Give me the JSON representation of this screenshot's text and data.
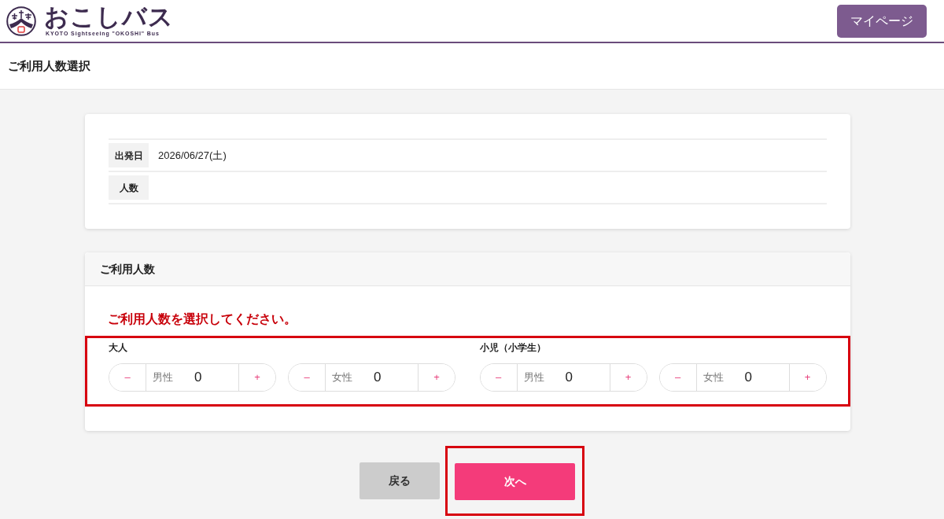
{
  "header": {
    "logo_title": "おこしバス",
    "logo_subtitle": "KYOTO Sightseeing \"OKOSHI\" Bus",
    "mypage_button": "マイページ"
  },
  "page_title": "ご利用人数選択",
  "summary": {
    "rows": [
      {
        "label": "出発日",
        "value": "2026/06/27(土)"
      },
      {
        "label": "人数"
      }
    ]
  },
  "passengers": {
    "title": "ご利用人数",
    "message": "ご利用人数を選択してください。",
    "highlighted": true,
    "groups": [
      {
        "label": "大人",
        "counters": [
          {
            "decrement": "–",
            "label": "男性",
            "value": "0",
            "increment": "+"
          },
          {
            "decrement": "–",
            "label": "女性",
            "value": "0",
            "increment": "+"
          }
        ]
      },
      {
        "label": "小児（小学生）",
        "counters": [
          {
            "decrement": "–",
            "label": "男性",
            "value": "0",
            "increment": "+"
          },
          {
            "decrement": "–",
            "label": "女性",
            "value": "0",
            "increment": "+"
          }
        ]
      }
    ]
  },
  "actions": {
    "buttons": [
      {
        "kind": "secondary",
        "label": "戻る",
        "highlighted": false
      },
      {
        "kind": "primary",
        "label": "次へ",
        "highlighted": true
      }
    ]
  }
}
